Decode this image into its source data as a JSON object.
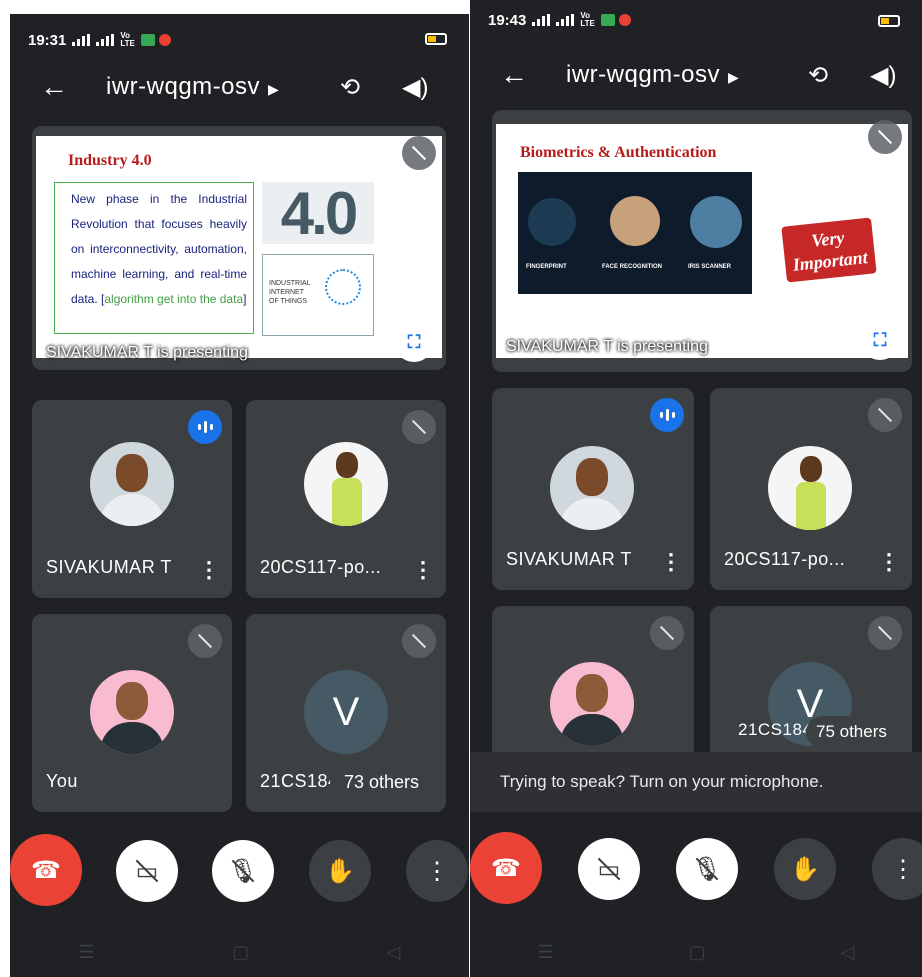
{
  "left_screen": {
    "status": {
      "time": "19:31",
      "volte": "Vo R\nLTE2"
    },
    "meeting_code": "iwr-wqgm-osv",
    "presentation": {
      "slide_title": "Industry 4.0",
      "slide_text_1": "New phase in the Industrial Revolution that focuses heavily on interconnectivity, automation, machine learning, and real-time data. [",
      "slide_text_hl": "algorithm get into the data",
      "slide_text_2": "]",
      "big_label": "4.0",
      "iot_label": "INDUSTRIAL INTERNET OF THINGS",
      "caption": "SIVAKUMAR T is presenting"
    },
    "tiles": [
      {
        "name": "SIVAKUMAR T"
      },
      {
        "name": "20CS117-po..."
      },
      {
        "name": "You"
      },
      {
        "name": "21CS184",
        "letter": "V",
        "others": "73 others"
      }
    ]
  },
  "right_screen": {
    "status": {
      "time": "19:43",
      "volte": "Vo R\nLTE2"
    },
    "meeting_code": "iwr-wqgm-osv",
    "presentation": {
      "slide_title": "Biometrics & Authentication",
      "labels": [
        "FINGERPRINT",
        "FACE RECOGNITION",
        "IRIS SCANNER"
      ],
      "sign_text": "Very Important",
      "caption": "SIVAKUMAR T is presenting"
    },
    "tiles": [
      {
        "name": "SIVAKUMAR T"
      },
      {
        "name": "20CS117-po..."
      },
      {
        "name": ""
      },
      {
        "name": "21CS184",
        "letter": "V",
        "others": "75 others"
      }
    ],
    "toast": "Trying to speak? Turn on your microphone."
  },
  "icons": {
    "back": "←",
    "switch_camera": "⟲",
    "speaker": "🔈",
    "fullscreen": "⛶",
    "mic_off": "🎙",
    "end_call": "☎",
    "camera_off": "▭",
    "raise_hand": "✋",
    "more": "⋮",
    "nav_menu": "☰",
    "nav_home": "▢",
    "nav_back": "◁"
  }
}
